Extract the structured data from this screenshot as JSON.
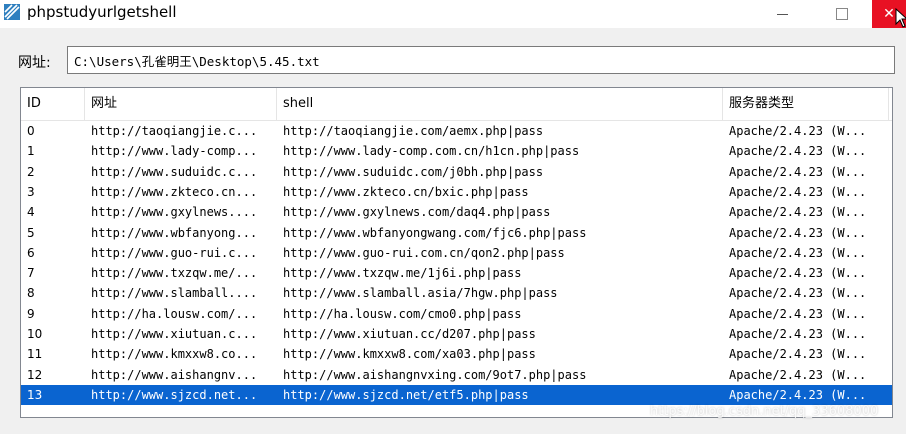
{
  "window": {
    "title": "phpstudyurlgetshell",
    "close_color": "#e81123"
  },
  "url_bar": {
    "label": "网址:",
    "value": "C:\\Users\\孔雀明王\\Desktop\\5.45.txt"
  },
  "table": {
    "columns": [
      "ID",
      "网址",
      "shell",
      "服务器类型"
    ],
    "selected_index": 13,
    "selection_color": "#0a64d0",
    "rows": [
      {
        "id": "0",
        "url": "http://taoqiangjie.c...",
        "shell": "http://taoqiangjie.com/aemx.php|pass",
        "type": "Apache/2.4.23 (W..."
      },
      {
        "id": "1",
        "url": "http://www.lady-comp...",
        "shell": "http://www.lady-comp.com.cn/h1cn.php|pass",
        "type": "Apache/2.4.23 (W..."
      },
      {
        "id": "2",
        "url": "http://www.suduidc.c...",
        "shell": "http://www.suduidc.com/j0bh.php|pass",
        "type": "Apache/2.4.23 (W..."
      },
      {
        "id": "3",
        "url": "http://www.zkteco.cn...",
        "shell": "http://www.zkteco.cn/bxic.php|pass",
        "type": "Apache/2.4.23 (W..."
      },
      {
        "id": "4",
        "url": "http://www.gxylnews....",
        "shell": "http://www.gxylnews.com/daq4.php|pass",
        "type": "Apache/2.4.23 (W..."
      },
      {
        "id": "5",
        "url": "http://www.wbfanyong...",
        "shell": "http://www.wbfanyongwang.com/fjc6.php|pass",
        "type": "Apache/2.4.23 (W..."
      },
      {
        "id": "6",
        "url": "http://www.guo-rui.c...",
        "shell": "http://www.guo-rui.com.cn/qon2.php|pass",
        "type": "Apache/2.4.23 (W..."
      },
      {
        "id": "7",
        "url": "http://www.txzqw.me/...",
        "shell": "http://www.txzqw.me/1j6i.php|pass",
        "type": "Apache/2.4.23 (W..."
      },
      {
        "id": "8",
        "url": "http://www.slamball....",
        "shell": "http://www.slamball.asia/7hgw.php|pass",
        "type": "Apache/2.4.23 (W..."
      },
      {
        "id": "9",
        "url": "http://ha.lousw.com/...",
        "shell": "http://ha.lousw.com/cmo0.php|pass",
        "type": "Apache/2.4.23 (W..."
      },
      {
        "id": "10",
        "url": "http://www.xiutuan.c...",
        "shell": "http://www.xiutuan.cc/d207.php|pass",
        "type": "Apache/2.4.23 (W..."
      },
      {
        "id": "11",
        "url": "http://www.kmxxw8.co...",
        "shell": "http://www.kmxxw8.com/xa03.php|pass",
        "type": "Apache/2.4.23 (W..."
      },
      {
        "id": "12",
        "url": "http://www.aishangnv...",
        "shell": "http://www.aishangnvxing.com/9ot7.php|pass",
        "type": "Apache/2.4.23 (W..."
      },
      {
        "id": "13",
        "url": "http://www.sjzcd.net...",
        "shell": "http://www.sjzcd.net/etf5.php|pass",
        "type": "Apache/2.4.23 (W..."
      }
    ]
  },
  "watermark": "https://blog.csdn.net/qq_33608000"
}
